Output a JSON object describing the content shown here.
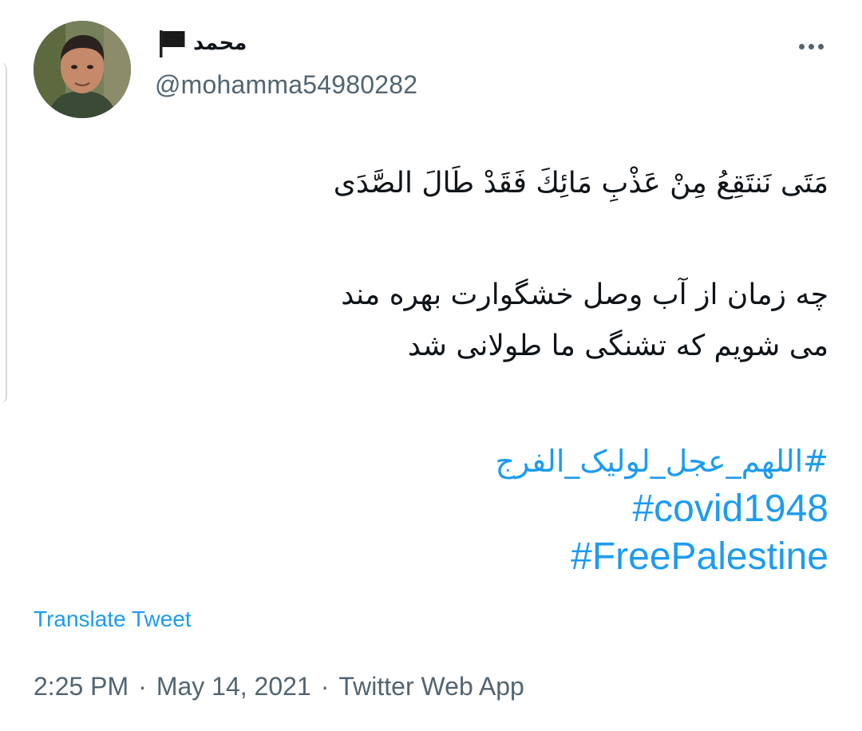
{
  "tweet": {
    "author": {
      "display_name": "محمد",
      "flag_emoji": "🏴",
      "handle": "@mohamma54980282"
    },
    "text": {
      "arabic_verse": "مَتَى نَنتَقِعُ مِنْ عَذْبِ مَائِكَ فَقَدْ طَالَ الصَّدَى",
      "persian_translation_line1": "چه زمان از آب وصل خشگوارت بهره مند",
      "persian_translation_line2": "می شویم که تشنگی ما طولانی شد"
    },
    "hashtags": [
      "#اللهم_عجل_لولیک_الفرج",
      "#covid1948",
      "#FreePalestine"
    ],
    "translate_label": "Translate Tweet",
    "time": "2:25 PM",
    "date": "May 14, 2021",
    "source": "Twitter Web App",
    "separator": "·",
    "colors": {
      "link": "#1d9bf0",
      "secondary_text": "#536471",
      "primary_text": "#0f1419"
    },
    "icons": {
      "more": "more-horizontal-icon",
      "flag": "black-flag-icon"
    }
  }
}
